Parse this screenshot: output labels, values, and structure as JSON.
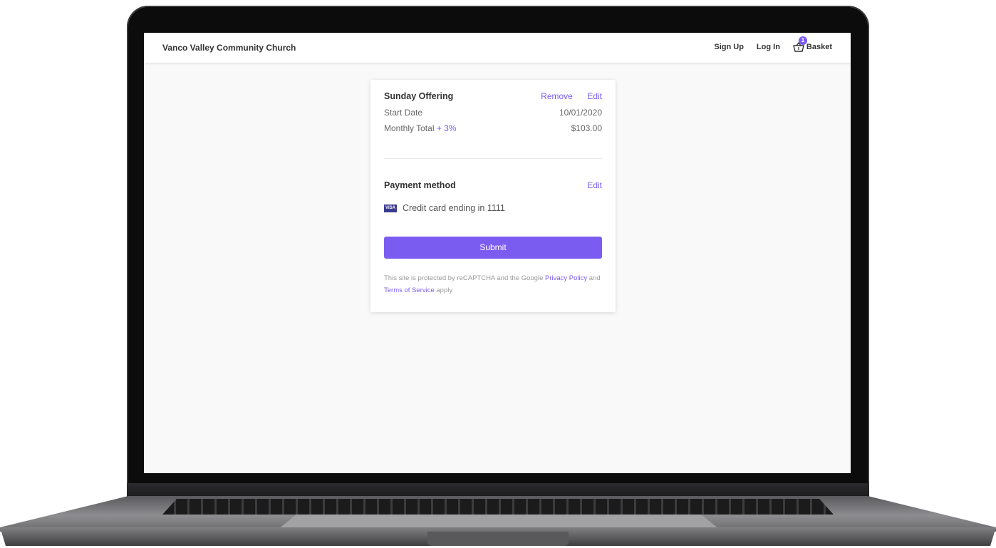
{
  "header": {
    "site_title": "Vanco Valley Community Church",
    "signup_label": "Sign Up",
    "login_label": "Log In",
    "basket_label": "Basket",
    "basket_count": "1"
  },
  "offering": {
    "title": "Sunday Offering",
    "remove_label": "Remove",
    "edit_label": "Edit",
    "start_date_label": "Start Date",
    "start_date_value": "10/01/2020",
    "monthly_total_label": "Monthly Total",
    "fee_label": "+ 3%",
    "monthly_total_value": "$103.00"
  },
  "payment": {
    "title": "Payment method",
    "edit_label": "Edit",
    "card_brand": "VISA",
    "card_text": "Credit card ending in 1111"
  },
  "submit_label": "Submit",
  "legal": {
    "text1": "This site is protected by reCAPTCHA and the Google ",
    "privacy_link": "Privacy Policy",
    "text2": " and ",
    "terms_link": "Terms of Service",
    "text3": " apply"
  },
  "colors": {
    "accent": "#7b5cf0",
    "background": "#f9f9f9"
  }
}
